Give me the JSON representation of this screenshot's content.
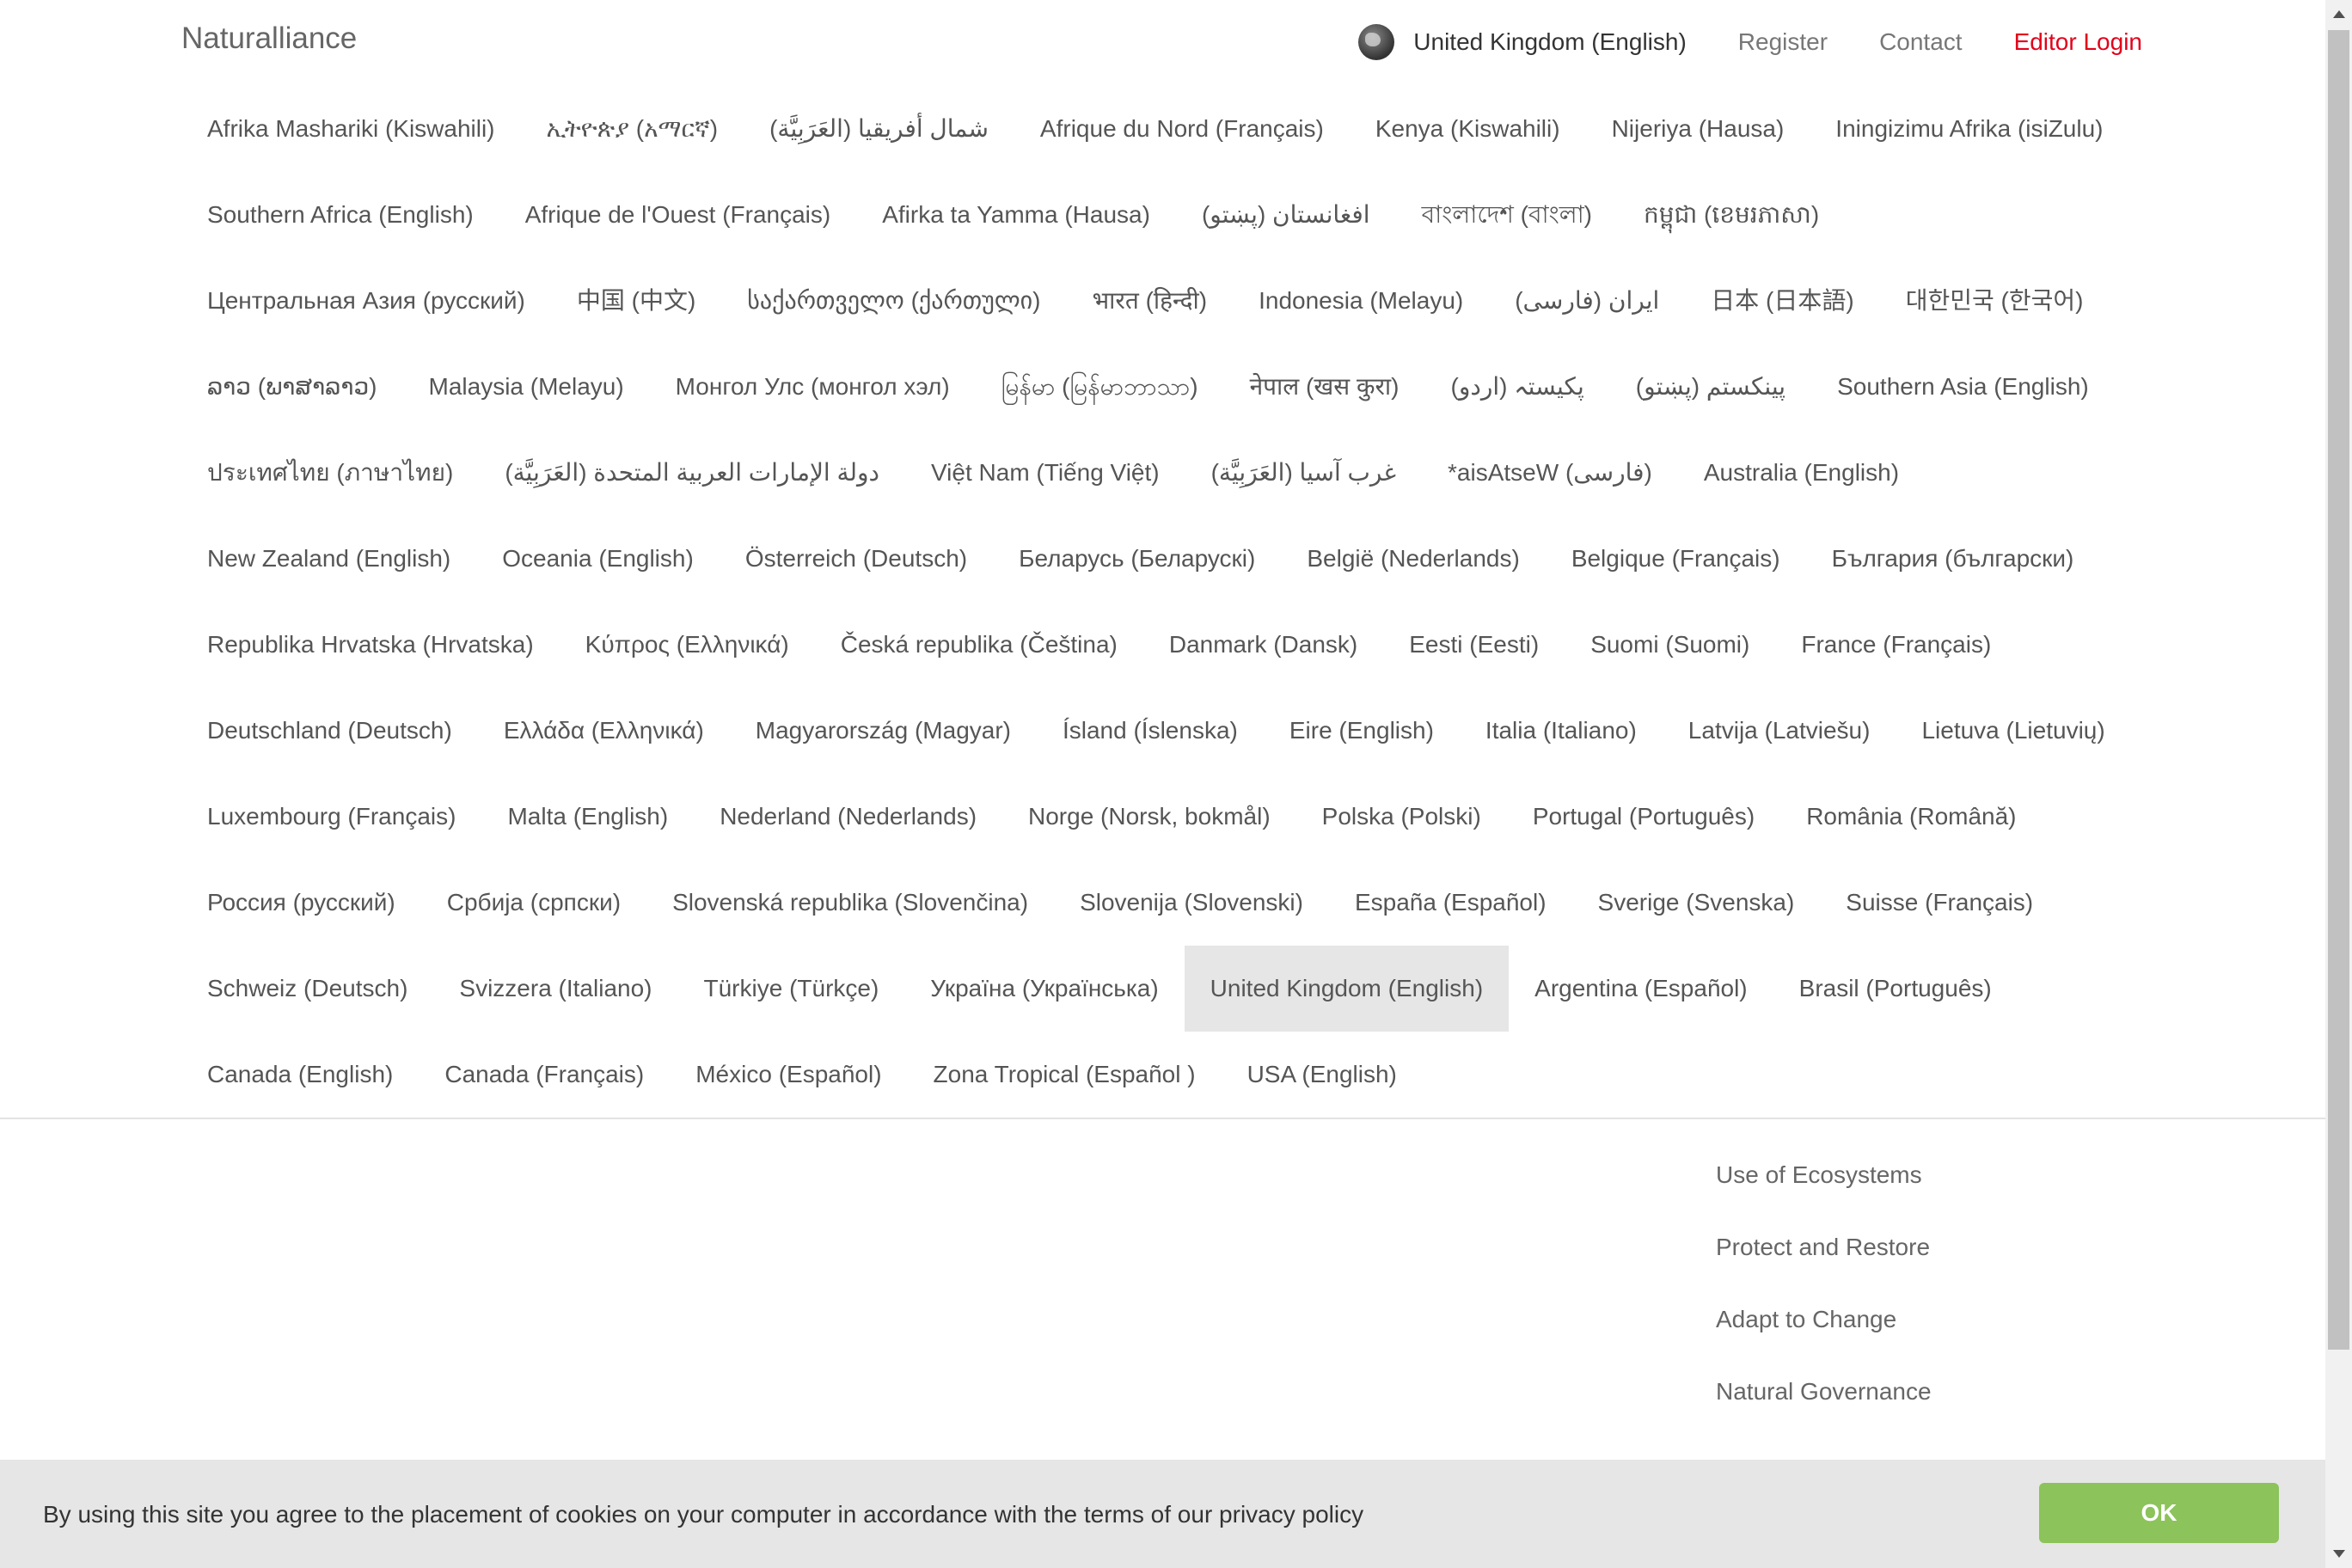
{
  "header": {
    "brand": "Naturalliance",
    "current_language": "United Kingdom (English)",
    "register": "Register",
    "contact": "Contact",
    "editor_login": "Editor Login",
    "editor_color": "#e3001b"
  },
  "countries": [
    "Afrika Mashariki (Kiswahili)",
    "ኢትዮጵያ (አማርኛ)",
    "شمال أفريقيا (العَرَبِيَّة)",
    "Afrique du Nord (Français)",
    "Kenya (Kiswahili)",
    "Nijeriya (Hausa)",
    "Iningizimu Afrika (isiZulu)",
    "Southern Africa (English)",
    "Afrique de l'Ouest (Français)",
    "Afirka ta Yamma (Hausa)",
    "افغانستان (پښتو)",
    "বাংলাদেশ (বাংলা)",
    "កម្ពុជា (ខេមរភាសា)",
    "Центральная Азия (русский)",
    "中国 (中文)",
    "საქართველო (ქართული)",
    "भारत (हिन्दी)",
    "Indonesia (Melayu)",
    "ایران (فارسی)",
    "日本 (日本語)",
    "대한민국 (한국어)",
    "ລາວ (ພາສາລາວ)",
    "Malaysia (Melayu)",
    "Монгол Улс (монгол хэл)",
    "မြန်မာ (မြန်မာဘာသာ)",
    "नेपाल (खस कुरा)",
    "پکیستہ (اردو)",
    "پینکستم (پښتو)",
    "Southern Asia (English)",
    "ประเทศไทย (ภาษาไทย)",
    "دولة الإمارات العربية المتحدة (العَرَبِيَّة)",
    "Việt Nam (Tiếng Việt)",
    "غرب آسيا (العَرَبِيَّة)",
    "*aisAtseW (فارسی)",
    "Australia (English)",
    "New Zealand (English)",
    "Oceania (English)",
    "Österreich (Deutsch)",
    "Беларусь (Беларускі)",
    "België (Nederlands)",
    "Belgique (Français)",
    "България (български)",
    "Republika Hrvatska (Hrvatska)",
    "Κύπρος (Ελληνικά)",
    "Česká republika (Čeština)",
    "Danmark (Dansk)",
    "Eesti (Eesti)",
    "Suomi (Suomi)",
    "France (Français)",
    "Deutschland (Deutsch)",
    "Ελλάδα (Ελληνικά)",
    "Magyarország (Magyar)",
    "Ísland (Íslenska)",
    "Eire (English)",
    "Italia (Italiano)",
    "Latvija (Latviešu)",
    "Lietuva (Lietuvių)",
    "Luxembourg (Français)",
    "Malta (English)",
    "Nederland (Nederlands)",
    "Norge (Norsk, bokmål)",
    "Polska (Polski)",
    "Portugal (Português)",
    "România (Română)",
    "Россия (русский)",
    "Србија (српски)",
    "Slovenská republika (Slovenčina)",
    "Slovenija (Slovenski)",
    "España (Español)",
    "Sverige (Svenska)",
    "Suisse (Français)",
    "Schweiz (Deutsch)",
    "Svizzera (Italiano)",
    "Türkiye (Türkçe)",
    "Україна (Українська)",
    "United Kingdom (English)",
    "Argentina (Español)",
    "Brasil (Português)",
    "Canada (English)",
    "Canada (Français)",
    "México (Español)",
    "Zona Tropical (Español )",
    "USA (English)"
  ],
  "active_country": "United Kingdom (English)",
  "footer_links": [
    "Use of Ecosystems",
    "Protect and Restore",
    "Adapt to Change",
    "Natural Governance"
  ],
  "cookie": {
    "text": "By using this site you agree to the placement of cookies on your computer in accordance with the terms of our privacy policy",
    "ok": "OK",
    "ok_color": "#8cc35a"
  }
}
